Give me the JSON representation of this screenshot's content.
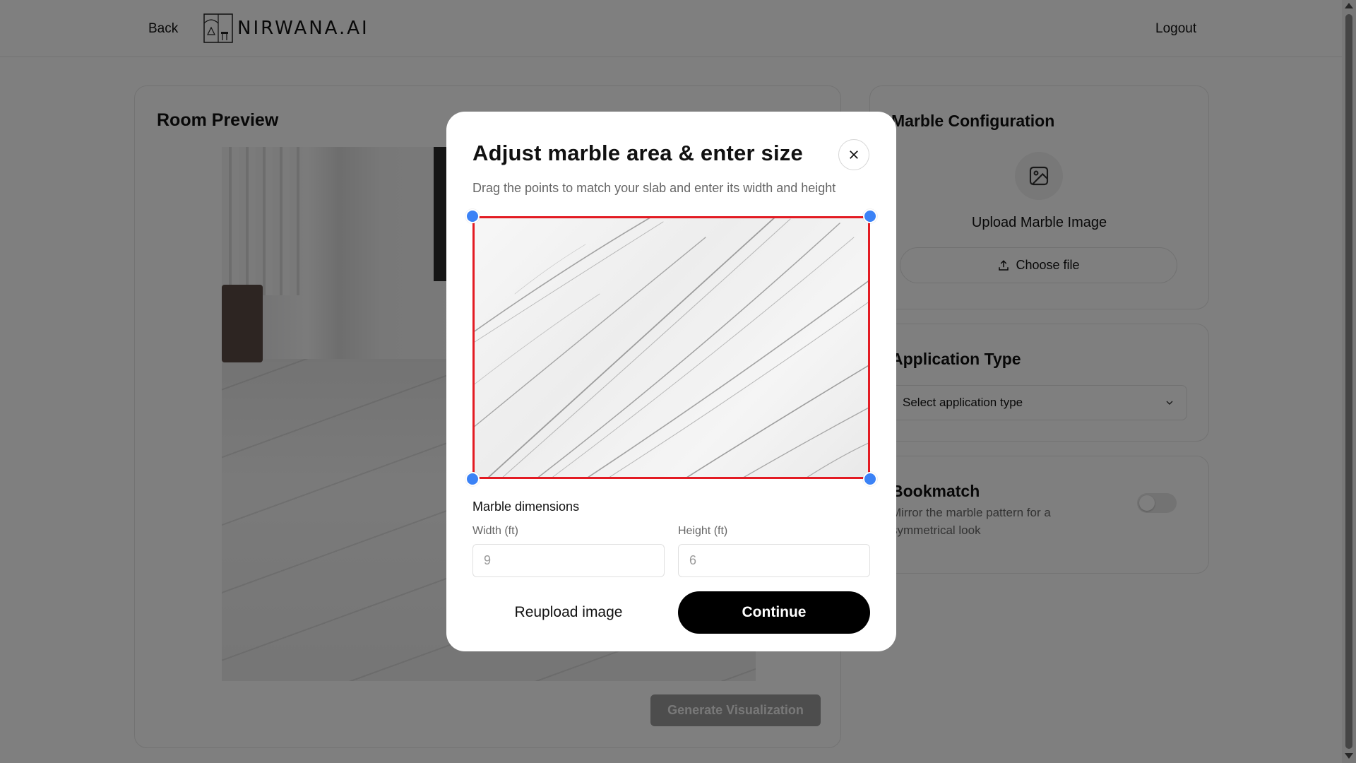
{
  "header": {
    "back_label": "Back",
    "logo_text": "NIRWANA.AI",
    "logout_label": "Logout"
  },
  "preview": {
    "title": "Room Preview",
    "generate_label": "Generate Visualization"
  },
  "config": {
    "title": "Marble Configuration",
    "upload_label": "Upload Marble Image",
    "choose_file_label": "Choose file"
  },
  "application_type": {
    "title": "Application Type",
    "select_value": "Select application type"
  },
  "bookmatch": {
    "title": "Bookmatch",
    "description": "Mirror the marble pattern for a symmetrical look",
    "enabled": false
  },
  "modal": {
    "title": "Adjust marble area & enter size",
    "subtitle": "Drag the points to match your slab and enter its width and height",
    "dimensions_label": "Marble dimensions",
    "width_label": "Width (ft)",
    "width_placeholder": "9",
    "height_label": "Height (ft)",
    "height_placeholder": "6",
    "reupload_label": "Reupload image",
    "continue_label": "Continue"
  },
  "colors": {
    "crop_outline": "#e31b23",
    "crop_handle": "#3b82f6",
    "primary_button": "#000000",
    "disabled_button": "#9b9b9b"
  },
  "icons": [
    "close-icon",
    "image-icon",
    "upload-icon",
    "chevron-down-icon"
  ]
}
